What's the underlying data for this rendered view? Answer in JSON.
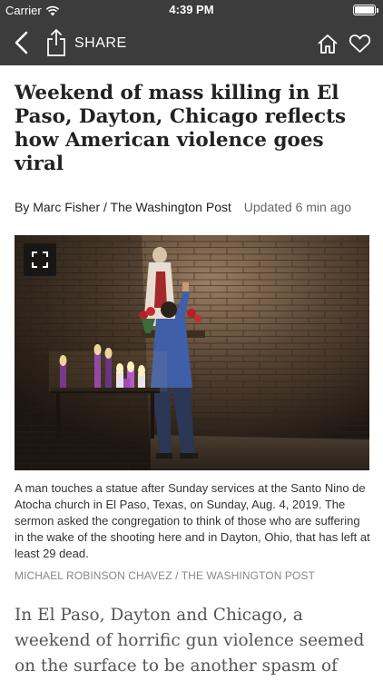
{
  "status_bar": {
    "carrier": "Carrier",
    "time": "4:39 PM"
  },
  "nav": {
    "share_label": "SHARE",
    "icons": [
      "back-icon",
      "share-icon",
      "home-icon",
      "heart-icon"
    ]
  },
  "article": {
    "headline": "Weekend of mass killing in El Paso, Dayton, Chicago reflects how American violence goes viral",
    "byline": "By Marc Fisher / The Washington Post",
    "updated": "Updated 6 min ago",
    "photo_caption": "A man touches a statue after Sunday services at the Santo Nino de Atocha church in El Paso, Texas, on Sunday, Aug. 4, 2019. The sermon asked the congregation to think of those who are suffering in the wake of the shooting here and in Dayton, Ohio, that has left at least 29 dead.",
    "photo_credit": "MICHAEL ROBINSON CHAVEZ / THE WASHINGTON POST",
    "body_start": "In El Paso, Dayton and Chicago, a weekend of horrific gun violence seemed on the surface to be another spasm of disconnected"
  }
}
